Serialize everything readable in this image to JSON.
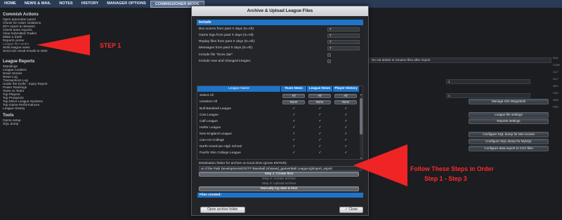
{
  "nav": {
    "tabs": [
      "HOME",
      "NEWS & MAIL",
      "NOTES",
      "HISTORY",
      "MANAGER OPTIONS",
      "COMMISSIONER MODE"
    ]
  },
  "sidebar": {
    "commish_title": "Commish Actions",
    "commish_items": [
      "Open automator panel",
      "Check for roster violations",
      "DFA report & releases",
      "Check team exports",
      "View Submitted Trades",
      "Make a trade",
      "Reports center",
      "League file center",
      "Write league news",
      "Send sim result emails to GMs"
    ],
    "reports_title": "League Reports",
    "reports_items": [
      "Standings",
      "League Leaders",
      "News Stories",
      "News Log",
      "Transactions Log",
      "Under the Knife - Injury Report",
      "Power Rankings",
      "Team vs Team",
      "Top Players",
      "Top Prospects",
      "Top Minor League Systems",
      "Top Game Performances",
      "League History"
    ],
    "tools_title": "Tools",
    "tools_items": [
      "Game setup",
      "SQL dump"
    ]
  },
  "background": {
    "rename_dropdown": "Do not delete or rename files after import",
    "field_a": "1",
    "field_b": "1",
    "buttons": [
      "Manage Sim Waypoints",
      "League file settings",
      "Reports settings",
      "Configure SQL dump for MS Access",
      "Configure SQL dump for MySQL",
      "Configure data export to CSV files"
    ],
    "right_icons": [
      "BUL",
      "COW",
      "CLF",
      "HLF",
      "NEL",
      "CAC",
      "NAH",
      "PRC"
    ]
  },
  "dialog": {
    "title": "Archive & Upload League Files",
    "include_header": "Include",
    "options": [
      {
        "label": "Box scores from past X days (0=All):",
        "value": "7"
      },
      {
        "label": "Game logs from past X days (0=All):",
        "value": "7"
      },
      {
        "label": "Replay files from past X days (0=All):",
        "value": "7"
      },
      {
        "label": "Messages from past X days (0=All):",
        "value": "7"
      }
    ],
    "check_options": [
      {
        "label": "Include file \"lscex.dat\":",
        "checked": false
      },
      {
        "label": "Include new and changed images:",
        "checked": false
      }
    ],
    "table": {
      "headers": [
        "League Name",
        "Team News",
        "League News",
        "Player History"
      ],
      "select_all": "Select All",
      "unselect_all": "Unselect All",
      "all_label": "All",
      "none_label": "None",
      "leagues": [
        "Bull Baseball League",
        "Cow League",
        "Calf League",
        "Heifer League",
        "New England League",
        "Can-Am College",
        "North American High School",
        "Pacific Rim College League"
      ]
    },
    "dest_label": "Destination folder for archive on local drive (press ENTER):",
    "dest_path": "ut of the Park Developments\\OOTP Baseball 24\\saved_games\\Bull League.lg\\import_export",
    "steps": {
      "step1": "Step 1: Create files",
      "step2": "Step 2: Create archive",
      "step3": "Step 3: Upload archive",
      "manual": "Manually log date & time"
    },
    "files_created": "Files created:",
    "open_button": "Open archive folder",
    "close_button": "Close",
    "close_icon_text": "✓"
  },
  "annotations": {
    "step1": "STEP 1",
    "follow_line1": "Follow These Steps in Order",
    "follow_line2": "Step 1 - Step 3",
    "color": "#ff2a2a"
  }
}
